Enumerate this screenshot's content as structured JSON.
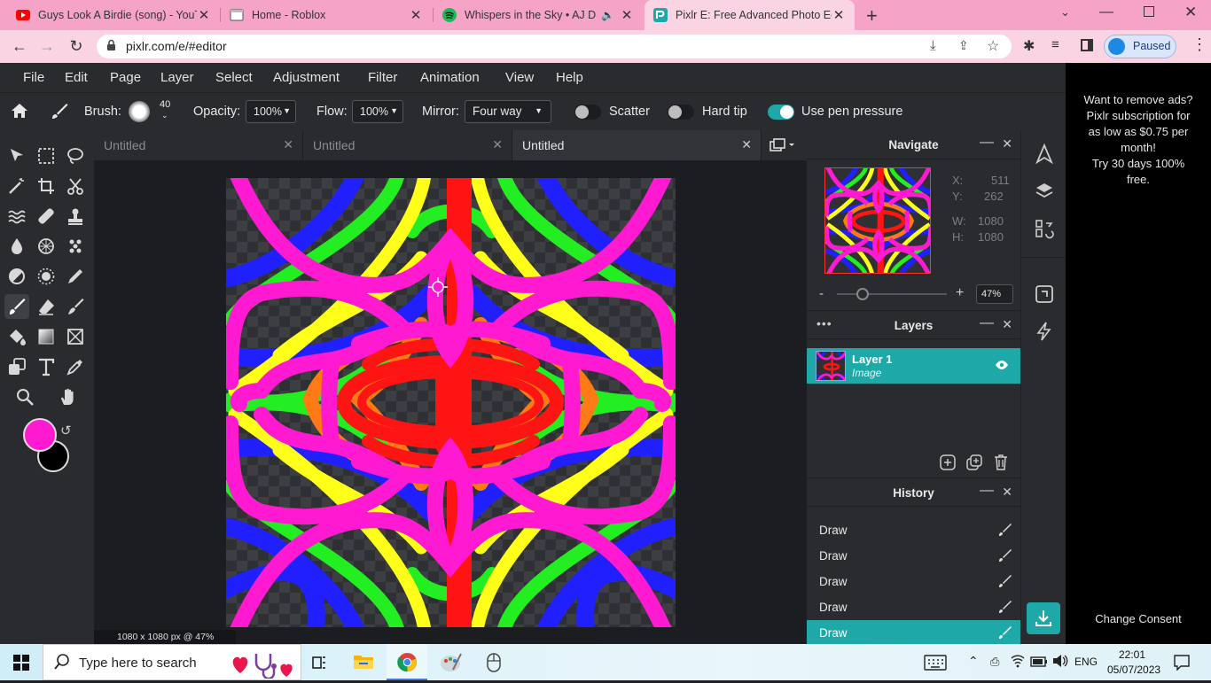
{
  "browser": {
    "tabs": [
      {
        "title": "Guys Look A Birdie (song) - YouTube",
        "icon": "youtube-icon"
      },
      {
        "title": "Home - Roblox",
        "icon": "roblox-icon"
      },
      {
        "title": "Whispers in the Sky • AJ Disp",
        "icon": "spotify-icon"
      },
      {
        "title": "Pixlr E: Free Advanced Photo Editor",
        "icon": "pixlr-icon"
      }
    ],
    "url": "pixlr.com/e/#editor",
    "profile_label": "Paused"
  },
  "menu": [
    "File",
    "Edit",
    "Page",
    "Layer",
    "Select",
    "Adjustment",
    "Filter",
    "Animation",
    "View",
    "Help"
  ],
  "options": {
    "brush_label": "Brush:",
    "brush_size": "40",
    "opacity_label": "Opacity:",
    "opacity_value": "100%",
    "flow_label": "Flow:",
    "flow_value": "100%",
    "mirror_label": "Mirror:",
    "mirror_value": "Four way",
    "scatter_label": "Scatter",
    "hard_tip_label": "Hard tip",
    "pen_pressure_label": "Use pen pressure"
  },
  "doc_tabs": [
    "Untitled",
    "Untitled",
    "Untitled"
  ],
  "status_text": "1080 x 1080 px @ 47%",
  "colors": {
    "primary": "#ff1ad1",
    "secondary": "#000000",
    "accent": "#1fa8a8"
  },
  "navigate": {
    "title": "Navigate",
    "x_label": "X:",
    "x_value": "511",
    "y_label": "Y:",
    "y_value": "262",
    "w_label": "W:",
    "w_value": "1080",
    "h_label": "H:",
    "h_value": "1080",
    "zoom_minus": "-",
    "zoom_plus": "+",
    "zoom_value": "47%",
    "zoom_fraction": 0.23
  },
  "layers": {
    "title": "Layers",
    "items": [
      {
        "name": "Layer 1",
        "type": "Image"
      }
    ]
  },
  "history": {
    "title": "History",
    "items": [
      "Draw",
      "Draw",
      "Draw",
      "Draw",
      "Draw"
    ]
  },
  "ad": {
    "text1": "Want to remove ads?",
    "text2": "Pixlr subscription for",
    "text3": "as low as $0.75 per",
    "text4": "month!",
    "text5": "Try 30 days 100%",
    "text6": "free.",
    "consent": "Change Consent"
  },
  "taskbar": {
    "search_placeholder": "Type here to search",
    "lang": "ENG",
    "time": "22:01",
    "date": "05/07/2023"
  }
}
